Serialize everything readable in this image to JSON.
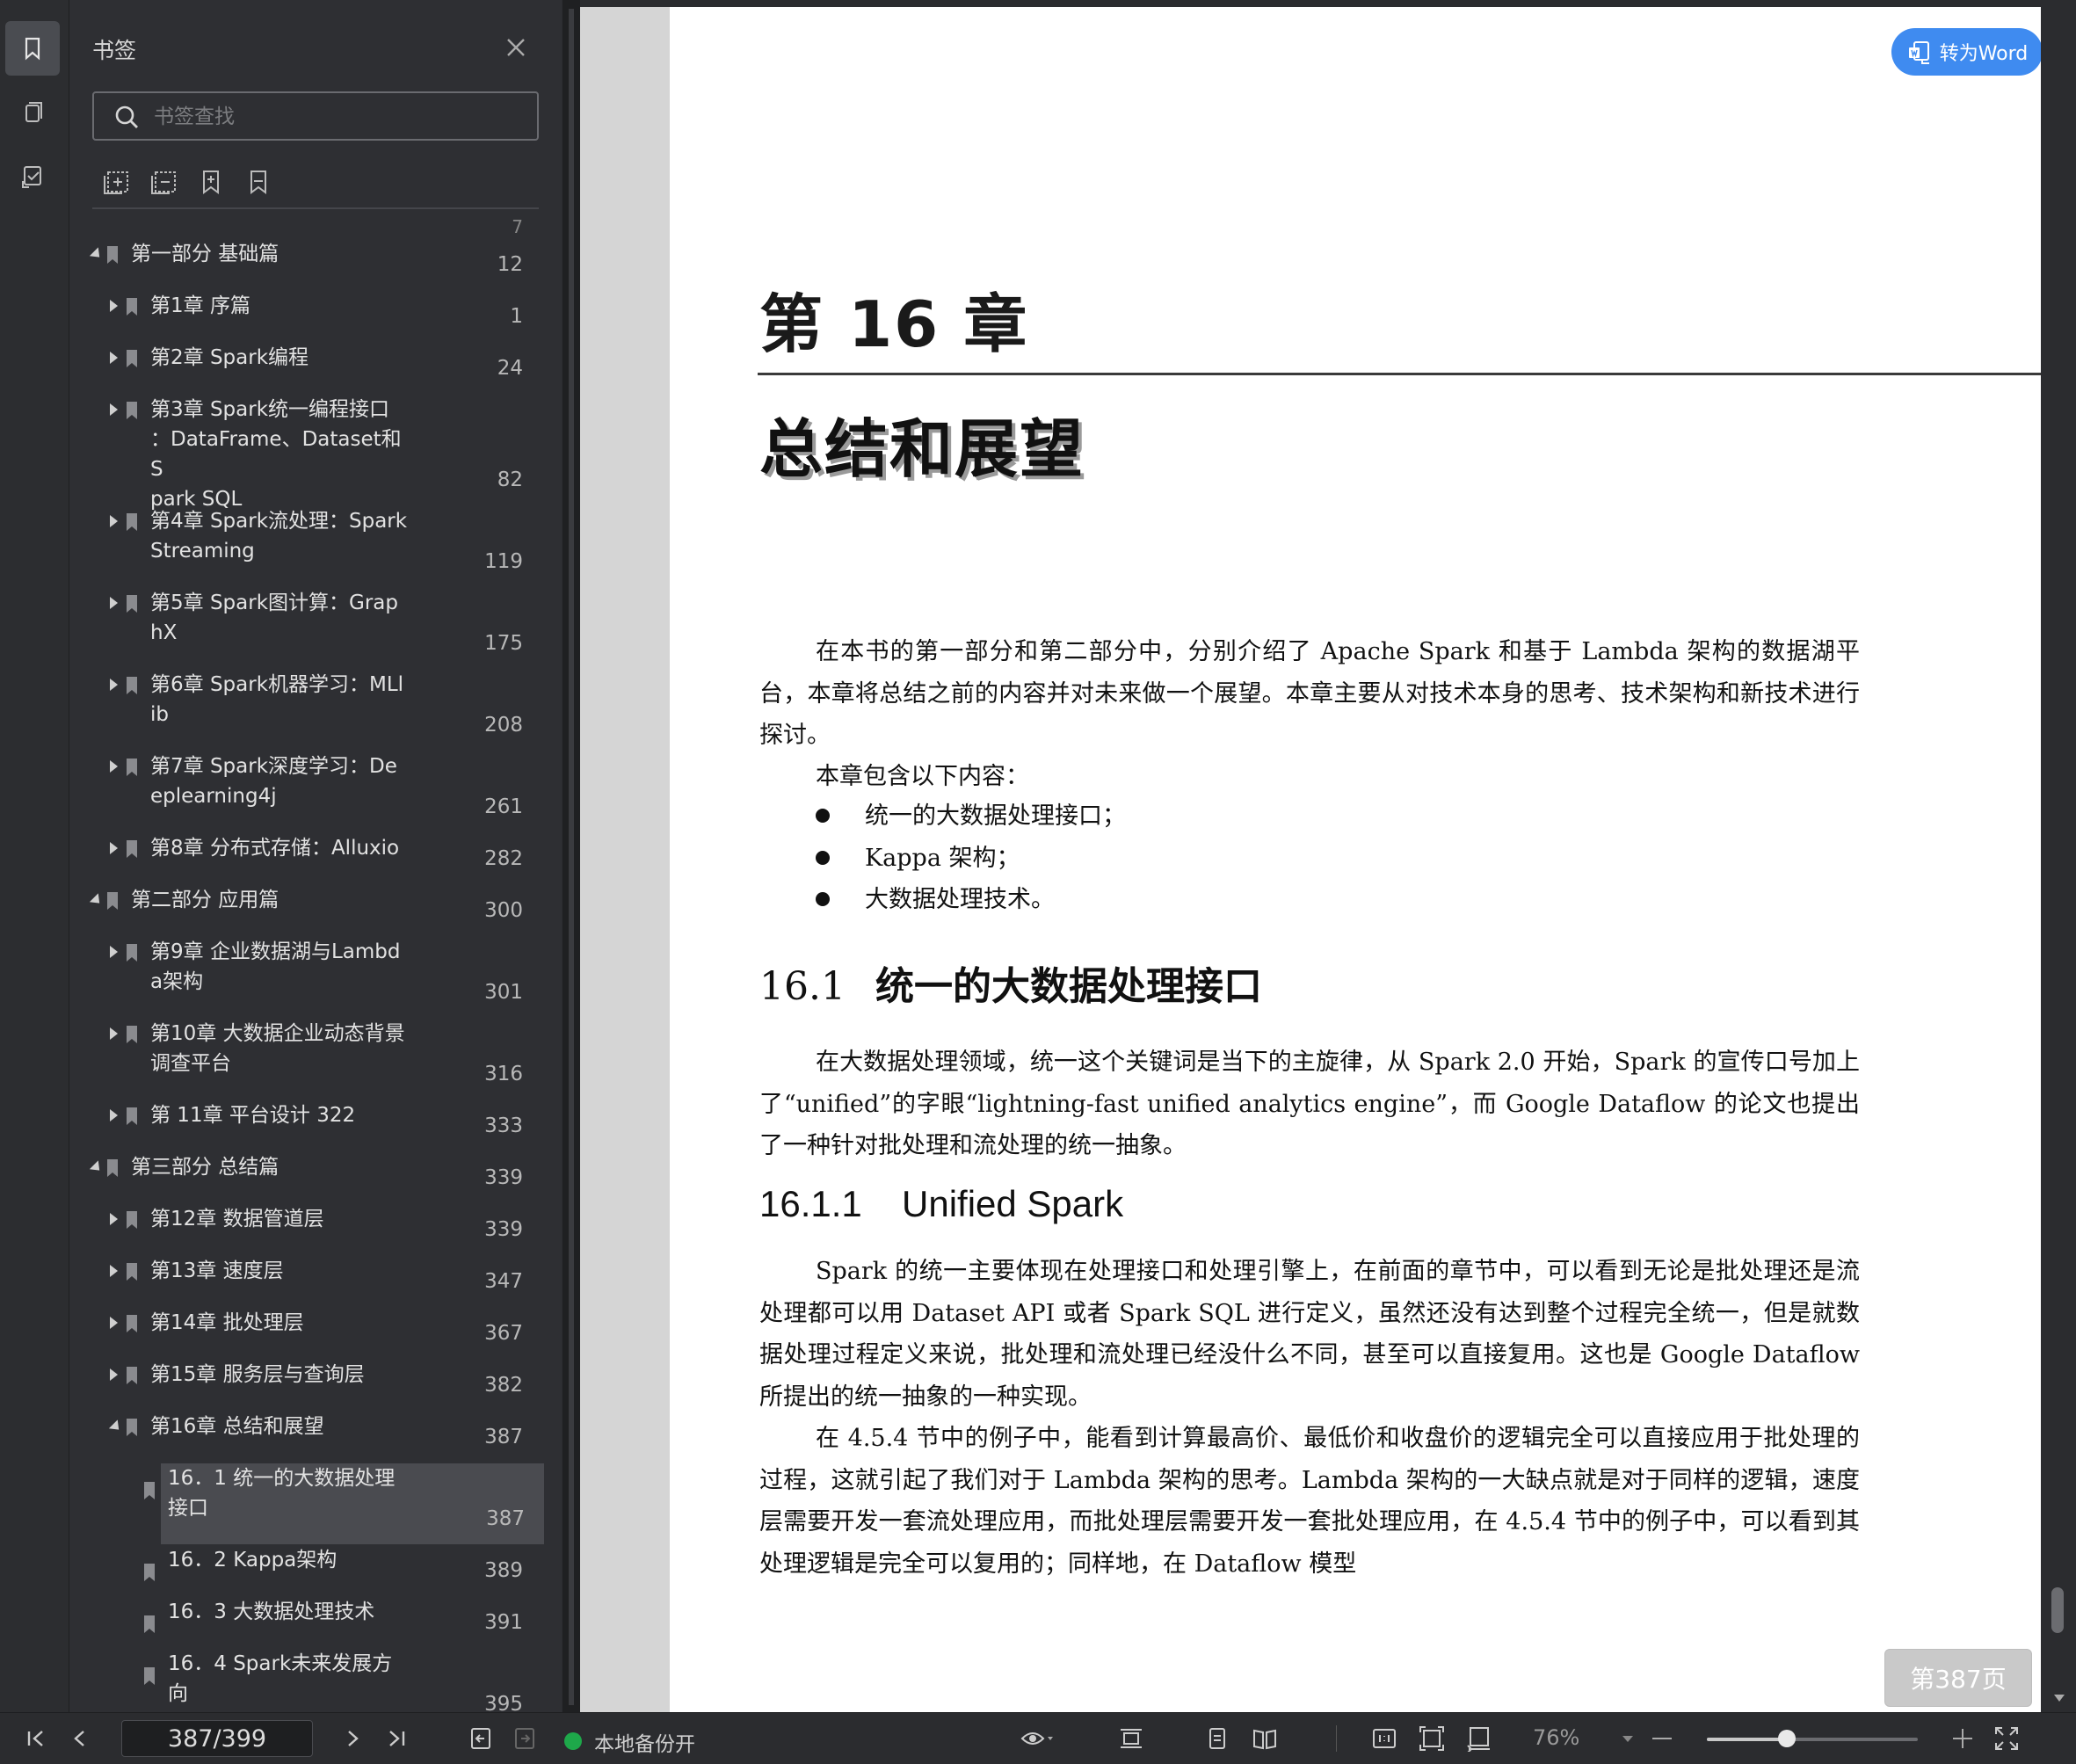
{
  "rail": {
    "items": [
      "bookmark-icon",
      "pages-icon",
      "annotation-icon"
    ]
  },
  "panel": {
    "title": "书签",
    "search_placeholder": "书签查找",
    "tools": [
      "expand-all-icon",
      "collapse-all-icon",
      "add-bookmark-icon",
      "bookmark-outline-icon"
    ],
    "top_cut_page": "7",
    "items": [
      {
        "label": "第一部分 基础篇",
        "page": "12",
        "level": 0,
        "arrow": "down"
      },
      {
        "label": "第1章 序篇",
        "page": "1",
        "level": 1,
        "arrow": "right"
      },
      {
        "label": "第2章 Spark编程",
        "page": "24",
        "level": 1,
        "arrow": "right"
      },
      {
        "label": "第3章 Spark统一编程接口\n：DataFrame、Dataset和S\npark SQL",
        "page": "82",
        "level": 1,
        "arrow": "right"
      },
      {
        "label": "第4章 Spark流处理：Spark\nStreaming",
        "page": "119",
        "level": 1,
        "arrow": "right"
      },
      {
        "label": "第5章 Spark图计算：Grap\nhX",
        "page": "175",
        "level": 1,
        "arrow": "right"
      },
      {
        "label": "第6章 Spark机器学习：MLl\nib",
        "page": "208",
        "level": 1,
        "arrow": "right"
      },
      {
        "label": "第7章 Spark深度学习：De\neplearning4j",
        "page": "261",
        "level": 1,
        "arrow": "right"
      },
      {
        "label": "第8章 分布式存储：Alluxio",
        "page": "282",
        "level": 1,
        "arrow": "right"
      },
      {
        "label": "第二部分 应用篇",
        "page": "300",
        "level": 0,
        "arrow": "down"
      },
      {
        "label": "第9章 企业数据湖与Lambd\na架构",
        "page": "301",
        "level": 1,
        "arrow": "right"
      },
      {
        "label": "第10章 大数据企业动态背景\n调查平台",
        "page": "316",
        "level": 1,
        "arrow": "right"
      },
      {
        "label": "第 11章 平台设计 322",
        "page": "333",
        "level": 1,
        "arrow": "right"
      },
      {
        "label": "第三部分 总结篇",
        "page": "339",
        "level": 0,
        "arrow": "down"
      },
      {
        "label": "第12章 数据管道层",
        "page": "339",
        "level": 1,
        "arrow": "right"
      },
      {
        "label": "第13章 速度层",
        "page": "347",
        "level": 1,
        "arrow": "right"
      },
      {
        "label": "第14章 批处理层",
        "page": "367",
        "level": 1,
        "arrow": "right"
      },
      {
        "label": "第15章 服务层与查询层",
        "page": "382",
        "level": 1,
        "arrow": "right"
      },
      {
        "label": "第16章 总结和展望",
        "page": "387",
        "level": 1,
        "arrow": "down"
      },
      {
        "label": "16．1 统一的大数据处理\n接口",
        "page": "387",
        "level": 2,
        "arrow": "none",
        "selected": true
      },
      {
        "label": "16．2 Kappa架构",
        "page": "389",
        "level": 2,
        "arrow": "none"
      },
      {
        "label": "16．3 大数据处理技术",
        "page": "391",
        "level": 2,
        "arrow": "none"
      },
      {
        "label": "16．4 Spark未来发展方\n向",
        "page": "395",
        "level": 2,
        "arrow": "none"
      }
    ]
  },
  "document": {
    "chapter_number": "第 16 章",
    "chapter_title": "总结和展望",
    "intro": "在本书的第一部分和第二部分中，分别介绍了 Apache Spark 和基于 Lambda 架构的数据湖平台，本章将总结之前的内容并对未来做一个展望。本章主要从对技术本身的思考、技术架构和新技术进行探讨。",
    "contents_lead": "本章包含以下内容：",
    "bullets": [
      "统一的大数据处理接口；",
      "Kappa 架构；",
      "大数据处理技术。"
    ],
    "section_num": "16.1",
    "section_title": "统一的大数据处理接口",
    "section_para": "在大数据处理领域，统一这个关键词是当下的主旋律，从 Spark 2.0 开始，Spark 的宣传口号加上了“unified”的字眼“lightning-fast unified analytics engine”，而 Google Dataflow 的论文也提出了一种针对批处理和流处理的统一抽象。",
    "subsection_num": "16.1.1",
    "subsection_title": "Unified Spark",
    "sub_para1": "Spark 的统一主要体现在处理接口和处理引擎上，在前面的章节中，可以看到无论是批处理还是流处理都可以用 Dataset API 或者 Spark SQL 进行定义，虽然还没有达到整个过程完全统一，但是就数据处理过程定义来说，批处理和流处理已经没什么不同，甚至可以直接复用。这也是 Google Dataflow 所提出的统一抽象的一种实现。",
    "sub_para2": "在 4.5.4 节中的例子中，能看到计算最高价、最低价和收盘价的逻辑完全可以直接应用于批处理的过程，这就引起了我们对于 Lambda 架构的思考。Lambda 架构的一大缺点就是对于同样的逻辑，速度层需要开发一套流处理应用，而批处理层需要开发一套批处理应用，在 4.5.4 节中的例子中，可以看到其处理逻辑是完全可以复用的；同样地，在 Dataflow 模型"
  },
  "convert_button": "转为Word",
  "page_badge": "第387页",
  "bottom": {
    "page_input": "387/399",
    "backup_label": "本地备份开",
    "zoom": "76%",
    "zoom_fraction": 0.38,
    "backup_color": "#1ea84a"
  }
}
